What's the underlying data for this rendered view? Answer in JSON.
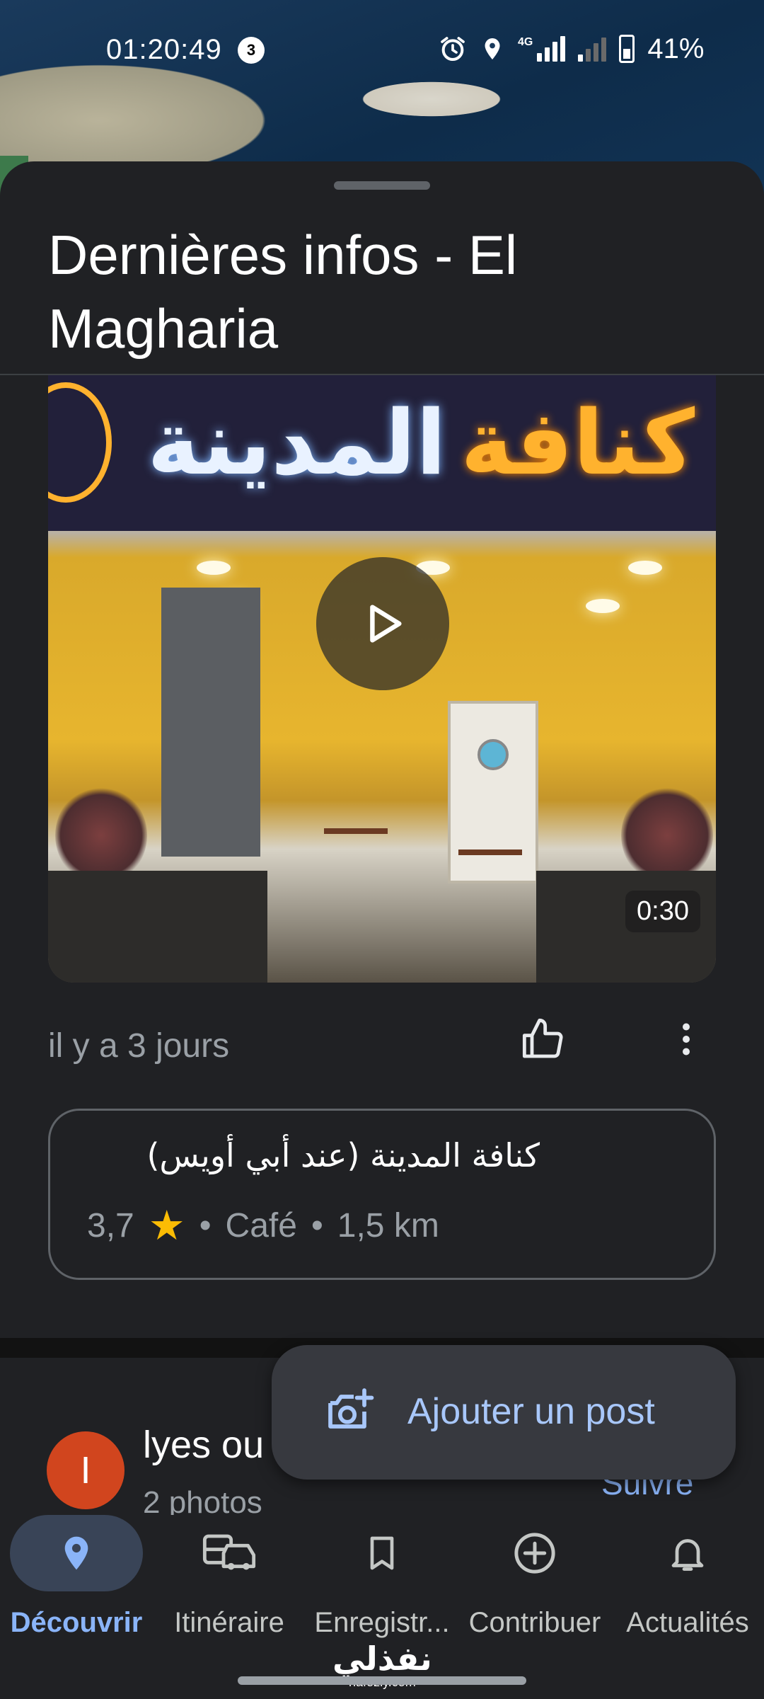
{
  "status_bar": {
    "time": "01:20:49",
    "notification_count": "3",
    "network": "4G",
    "battery": "41%",
    "icons": [
      "alarm-icon",
      "location-icon",
      "signal-icon",
      "battery-icon"
    ]
  },
  "sheet": {
    "title": "Dernières infos - El Magharia"
  },
  "video": {
    "sign_text_primary": "كنافة",
    "sign_text_secondary": "المدينة",
    "duration": "0:30"
  },
  "post": {
    "posted_ago": "il y a 3 jours"
  },
  "place_card": {
    "name": "كنافة المدينة (عند أبي أويس)",
    "rating": "3,7",
    "category": "Café",
    "distance": "1,5 km",
    "separator": "•"
  },
  "next_post": {
    "avatar_letter": "I",
    "author": "lyes ou",
    "subtitle": "2 photos",
    "follow_label": "Suivre"
  },
  "fab": {
    "label": "Ajouter un post"
  },
  "bottom_nav": {
    "items": [
      {
        "label": "Découvrir",
        "active": true
      },
      {
        "label": "Itinéraire",
        "active": false
      },
      {
        "label": "Enregistr...",
        "active": false
      },
      {
        "label": "Contribuer",
        "active": false
      },
      {
        "label": "Actualités",
        "active": false
      }
    ]
  },
  "watermark": {
    "arabic": "نفذلي",
    "latin": "nafezly.com"
  },
  "colors": {
    "background": "#202124",
    "accent": "#8ab4f8",
    "star": "#fbbc04",
    "avatar": "#d1451e"
  }
}
